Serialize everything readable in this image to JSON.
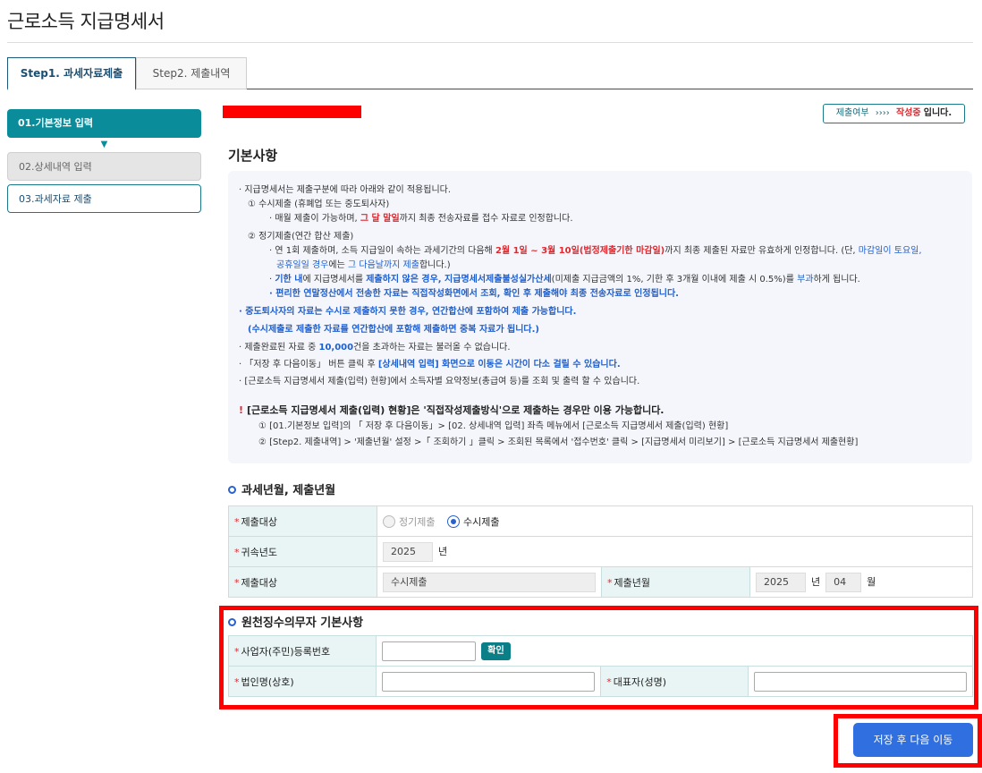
{
  "page_title": "근로소득 지급명세서",
  "tabs": [
    {
      "label": "Step1. 과세자료제출"
    },
    {
      "label": "Step2. 제출내역"
    }
  ],
  "steps": [
    {
      "label": "01.기본정보 입력"
    },
    {
      "label": "02.상세내역 입력"
    },
    {
      "label": "03.과세자료 제출"
    }
  ],
  "step_arrow": "▼",
  "status": {
    "prefix": "제출여부",
    "arrows": "››››",
    "state": "작성중",
    "suffix": "입니다."
  },
  "basic_title": "기본사항",
  "notice": {
    "l1": "· 지급명세서는 제출구분에 따라 아래와 같이 적용됩니다.",
    "l2": "① 수시제출 (휴폐업 또는 중도퇴사자)",
    "l3a": "· 매월 제출이 가능하며, ",
    "l3b": "그 달 말일",
    "l3c": "까지 최종 전송자료를 접수 자료로 인정합니다.",
    "l4": "② 정기제출(연간 합산 제출)",
    "l5a": "· 연 1회 제출하며, 소득 지급일이 속하는 과세기간의 다음해 ",
    "l5b": "2월 1일 ~ 3월 10일(법정제출기한 마감일)",
    "l5c": "까지 최종 제출된 자료만 유효하게 인정합니다. (단, ",
    "l5d": "마감일이 토요일,",
    "l6a": "공휴일일 경우",
    "l6b": "에는 ",
    "l6c": "그 다음날까지 제출",
    "l6d": "합니다.)",
    "l7a": "· ",
    "l7b": "기한 내",
    "l7c": "에 지급명세서를 ",
    "l7d": "제출하지 않은 경우, 지급명세서제출불성실가산세",
    "l7e": "(미제출 지급금액의 1%, 기한 후 3개월 이내에 제출 시 0.5%)를 ",
    "l7f": "부과",
    "l7g": "하게 됩니다.",
    "l8": "· 편리한 연말정산에서 전송한 자료는 직접작성화면에서 조회, 확인 후 제출해야 최종 전송자료로 인정됩니다.",
    "l9": "· 중도퇴사자의 자료는 수시로 제출하지 못한 경우, 연간합산에 포함하여 제출 가능합니다.",
    "l10": "(수시제출로 제출한 자료를 연간합산에 포함해 제출하면 중복 자료가 됩니다.)",
    "l11a": "· 제출완료된 자료 중 ",
    "l11b": "10,000",
    "l11c": "건을 초과하는 자료는 불러올 수 없습니다.",
    "l12a": "· 「저장 후 다음이동」 버튼 클릭 후 ",
    "l12b": "[상세내역 입력] 화면으로 이동은 시간이 다소 걸릴 수 있습니다.",
    "l13": "· [근로소득 지급명세서 제출(입력) 현황]에서 소득자별 요약정보(총급여 등)를 조회 및 출력 할 수 있습니다.",
    "warn_mark": "!",
    "warn": "[근로소득 지급명세서 제출(입력) 현황]은 '직접작성제출방식'으로 제출하는 경우만 이용 가능합니다.",
    "w1": "① [01.기본정보 입력]의 「 저장 후 다음이동」> [02. 상세내역 입력] 좌측 메뉴에서 [근로소득 지급명세서 제출(입력) 현황]",
    "w2": "② [Step2. 제출내역] > '제출년월' 설정 >「 조회하기 」클릭 > 조회된 목록에서 '접수번호' 클릭 > [지급명세서 미리보기] > [근로소득 지급명세서 제출현황]"
  },
  "section1": {
    "title": "과세년월, 제출년월",
    "req": "*",
    "row1_label": "제출대상",
    "radio1": "정기제출",
    "radio2": "수시제출",
    "radio_selected": "수시제출",
    "row2_label": "귀속년도",
    "year_value": "2025",
    "year_unit": "년",
    "row3_label": "제출대상",
    "target_value": "수시제출",
    "row3_label2": "제출년월",
    "submit_year": "2025",
    "submit_year_unit": "년",
    "submit_month": "04",
    "submit_month_unit": "월"
  },
  "section2": {
    "title": "원천징수의무자 기본사항",
    "req": "*",
    "reg_label": "사업자(주민)등록번호",
    "reg_value": "",
    "confirm_btn": "확인",
    "corp_label": "법인명(상호)",
    "corp_value": "",
    "rep_label": "대표자(성명)",
    "rep_value": ""
  },
  "next_button": "저장 후 다음 이동"
}
